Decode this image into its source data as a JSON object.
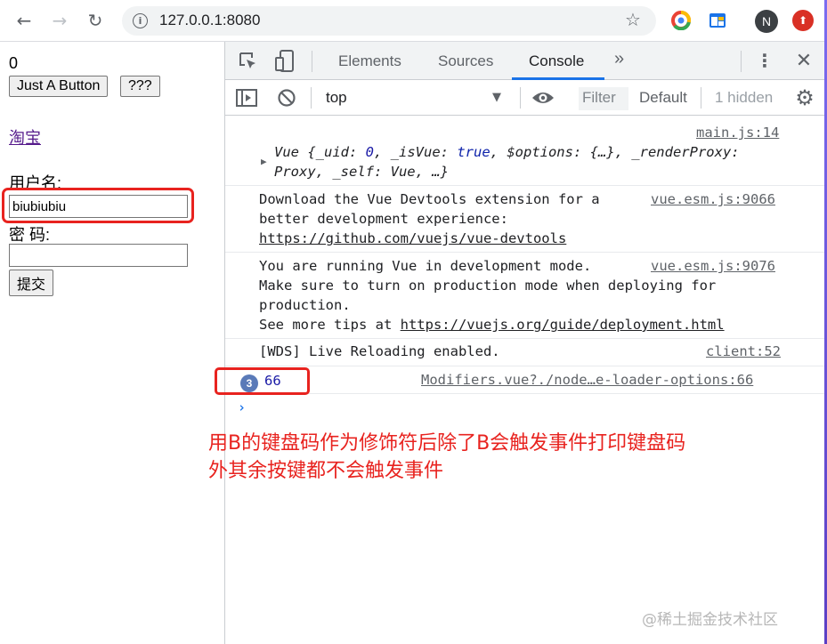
{
  "browser": {
    "url": "127.0.0.1:8080",
    "avatar_initial": "N"
  },
  "page": {
    "counter": "0",
    "button_1": "Just A Button",
    "button_2": "???",
    "link": "淘宝",
    "username_label": "用户名:",
    "username_value": "biubiubiu",
    "password_label": "密 码:",
    "password_value": "",
    "submit_label": "提交"
  },
  "devtools": {
    "tabs": [
      "Elements",
      "Sources",
      "Console"
    ],
    "active_tab": "Console",
    "more_tabs": "»",
    "context": "top",
    "filter_placeholder": "Filter",
    "levels": "Default levels",
    "hidden": "1 hidden",
    "messages": [
      {
        "source": "main.js:14",
        "text_1": "Vue {_uid: ",
        "num_1": "0",
        "text_2": ", _isVue: ",
        "kw_1": "true",
        "text_3": ", $options: {…}, _renderProxy:",
        "line_2": "Proxy, _self: Vue, …}"
      },
      {
        "source": "vue.esm.js:9066",
        "lines": [
          "Download the Vue Devtools extension for a",
          "better development experience:"
        ],
        "link": "https://github.com/vuejs/vue-devtools"
      },
      {
        "source": "vue.esm.js:9076",
        "lines": [
          "You are running Vue in development mode.",
          "Make sure to turn on production mode when deploying for",
          "production."
        ],
        "prefix": "See more tips at ",
        "link": "https://vuejs.org/guide/deployment.html"
      },
      {
        "source": "client:52",
        "text": "[WDS] Live Reloading enabled."
      },
      {
        "repeat_count": "3",
        "value": "66",
        "source": "Modifiers.vue?./node…e-loader-options:66"
      }
    ],
    "prompt": "›"
  },
  "annotation": {
    "line_1": "用B的键盘码作为修饰符后除了B会触发事件打印键盘码",
    "line_2": "外其余按键都不会触发事件",
    "color": "#e8231f"
  },
  "watermark": "@稀土掘金技术社区"
}
